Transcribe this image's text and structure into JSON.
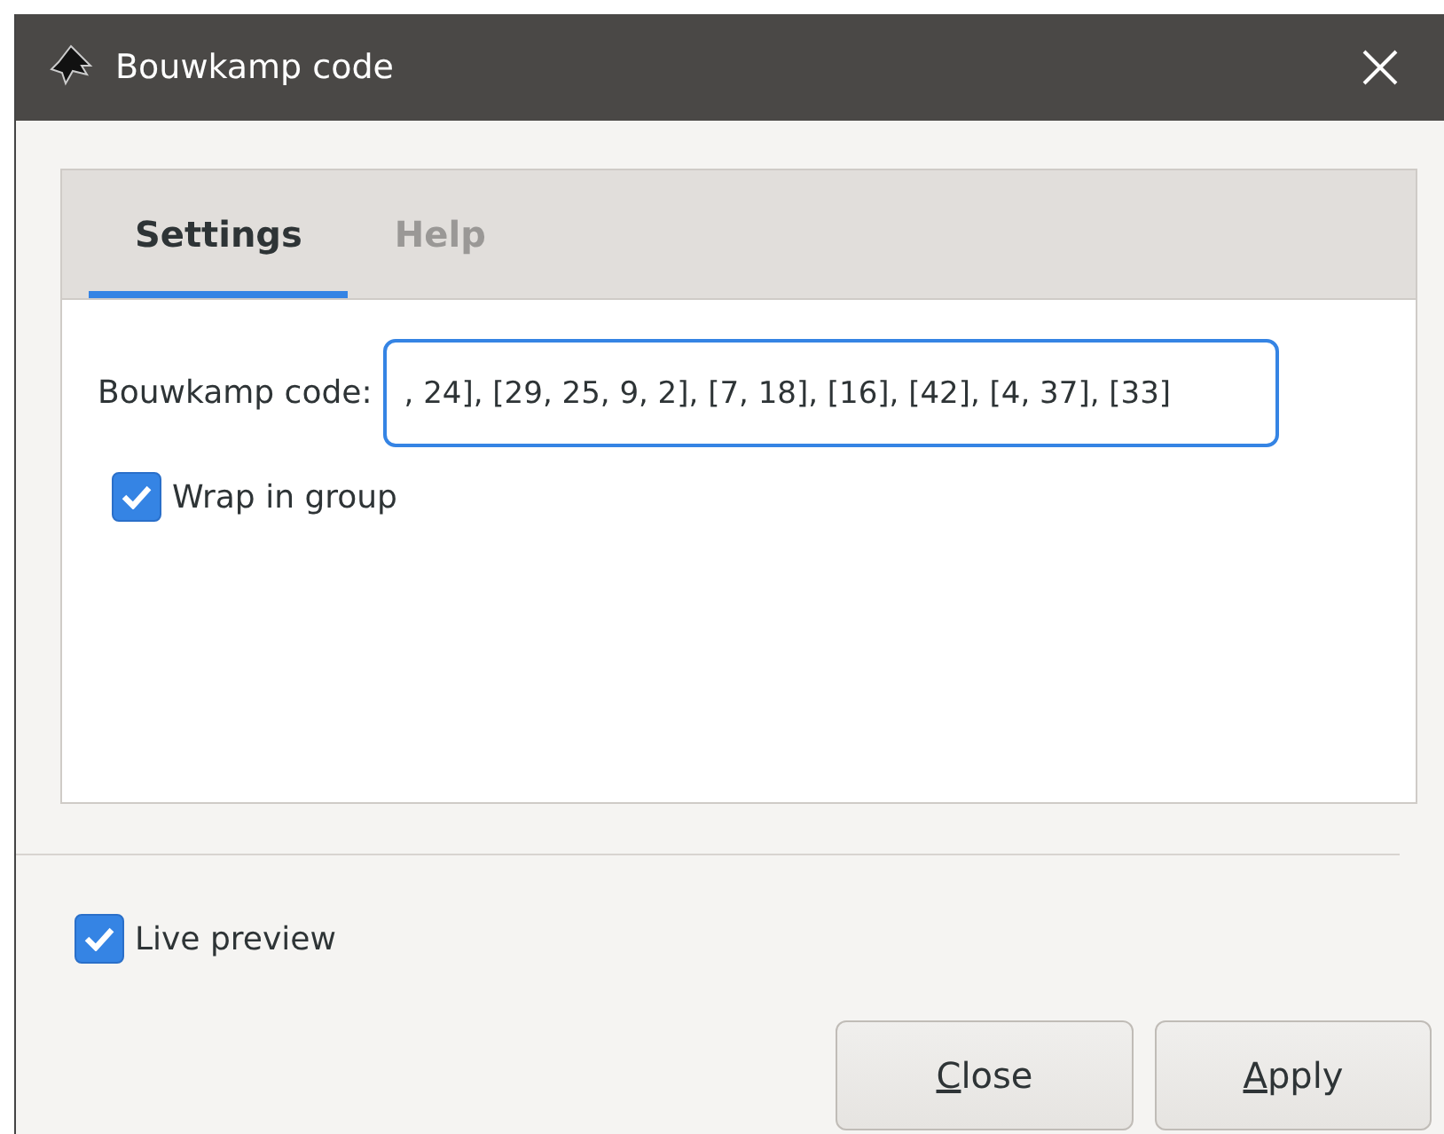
{
  "window": {
    "title": "Bouwkamp code"
  },
  "tabs": [
    {
      "label": "Settings",
      "selected": true
    },
    {
      "label": "Help",
      "selected": false
    }
  ],
  "field": {
    "label": "Bouwkamp code:",
    "value": ", 24], [29, 25, 9, 2], [7, 18], [16], [42], [4, 37], [33]"
  },
  "wrap_in_group": {
    "label": "Wrap in group",
    "checked": true
  },
  "live_preview": {
    "label": "Live preview",
    "checked": true
  },
  "buttons": [
    {
      "label": "Close"
    },
    {
      "label": "Apply"
    }
  ]
}
